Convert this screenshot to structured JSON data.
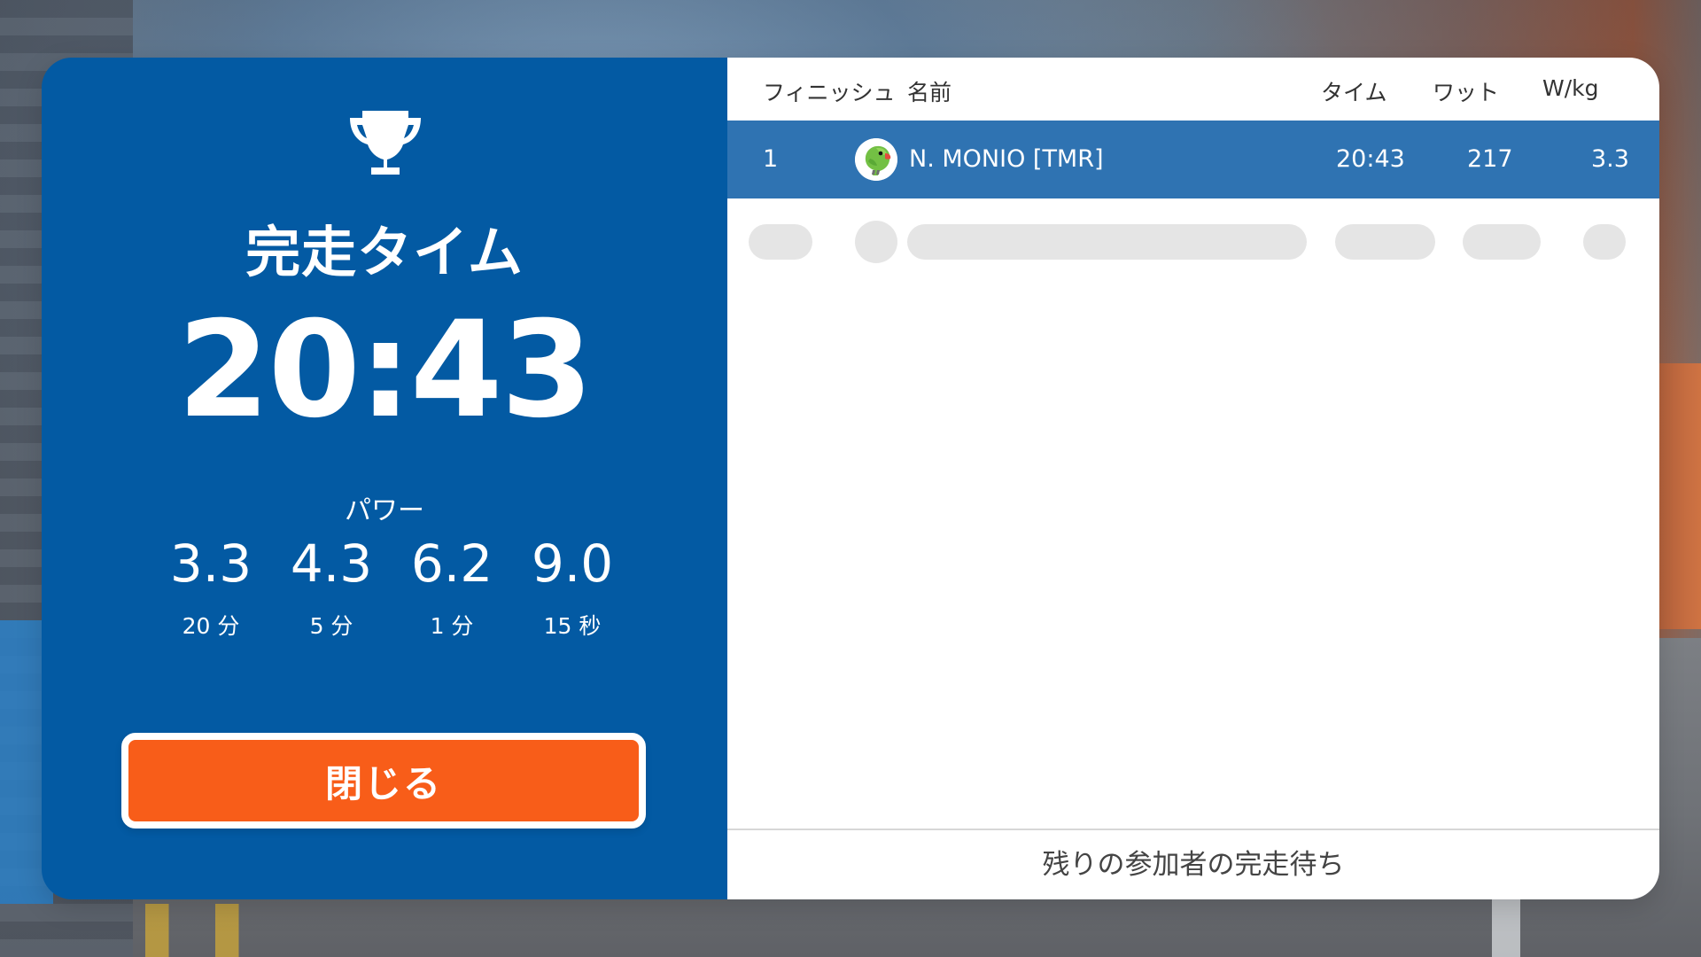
{
  "background": {
    "panel_left_color": "#035aa3",
    "highlight_row_color": "#2f73b2",
    "close_button_color": "#f85d19"
  },
  "left_panel": {
    "trophy_icon": "trophy-icon",
    "title": "完走タイム",
    "time": "20:43",
    "power_label": "パワー",
    "power_stats": [
      {
        "value": "3.3",
        "duration": "20 分"
      },
      {
        "value": "4.3",
        "duration": "5 分"
      },
      {
        "value": "6.2",
        "duration": "1 分"
      },
      {
        "value": "9.0",
        "duration": "15 秒"
      }
    ],
    "close_button_label": "閉じる"
  },
  "right_panel": {
    "headers": {
      "finish": "フィニッシュ",
      "name": "名前",
      "time": "タイム",
      "watt": "ワット",
      "wkg": "W/kg"
    },
    "rows": [
      {
        "rank": "1",
        "avatar_icon": "parrot-avatar-icon",
        "name": "N. MONIO [TMR]",
        "time": "20:43",
        "watt": "217",
        "wkg": "3.3"
      }
    ],
    "waiting_text": "残りの参加者の完走待ち"
  }
}
